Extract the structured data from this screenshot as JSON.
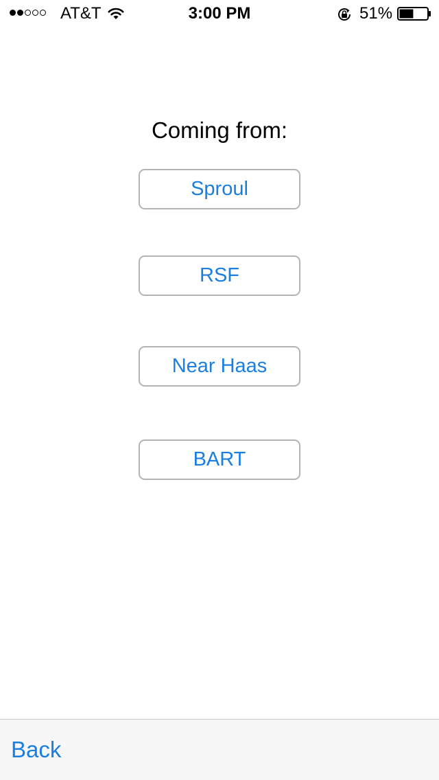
{
  "status_bar": {
    "signal_bars_filled": 2,
    "signal_bars_total": 5,
    "carrier": "AT&T",
    "time": "3:00 PM",
    "battery_percent": "51%",
    "battery_level": 0.51,
    "icons": [
      "wifi-icon",
      "lock-rotation-icon",
      "battery-icon"
    ]
  },
  "main": {
    "title": "Coming from:",
    "options": [
      {
        "label": "Sproul"
      },
      {
        "label": "RSF"
      },
      {
        "label": "Near Haas"
      },
      {
        "label": "BART"
      }
    ]
  },
  "toolbar": {
    "back_label": "Back"
  },
  "colors": {
    "accent": "#1a7fe0",
    "button_border": "#b4b4b4",
    "toolbar_bg": "#f7f7f7"
  }
}
